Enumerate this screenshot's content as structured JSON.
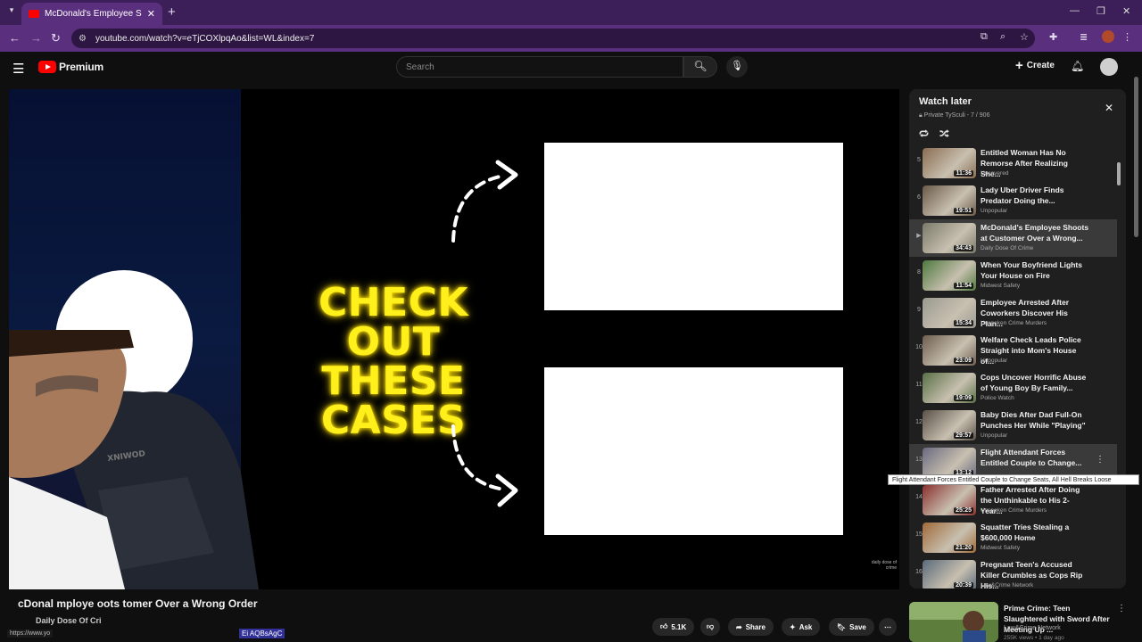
{
  "browser": {
    "tab_title": "McDonald's Employee Shoots a",
    "url": "youtube.com/watch?v=eTjCOXlpqAo&list=WL&index=7"
  },
  "header": {
    "logo_text": "Premium",
    "search_placeholder": "Search",
    "create_label": "Create"
  },
  "video": {
    "caption_line1": "CHECK OUT",
    "caption_line2": "THESE CASES",
    "watermark": "daily dose of crime",
    "title": "cDonal   mploye   oots   tomer Over a Wrong Order",
    "channel": "Daily Dose Of Cri",
    "status_url": "https://www.yo",
    "url_fragment": "Ei AQBsAgC"
  },
  "actions": {
    "likes": "5.1K",
    "share": "Share",
    "ask": "Ask",
    "save": "Save"
  },
  "playlist": {
    "title": "Watch later",
    "subtitle": "Private TySculi - 7 / 906",
    "items": [
      {
        "num": "5",
        "title": "Entitled Woman Has No Remorse After Realizing She...",
        "channel": "Uncovered",
        "duration": "11:36",
        "thumb_color": "#8a6d52"
      },
      {
        "num": "6",
        "title": "Lady Uber Driver Finds Predator Doing the...",
        "channel": "Unpopular",
        "duration": "19:51",
        "thumb_color": "#6b5a48"
      },
      {
        "num": "▶",
        "title": "McDonald's Employee Shoots at Customer Over a Wrong...",
        "channel": "Daily Dose Of Crime",
        "duration": "34:43",
        "thumb_color": "#7a7a6a"
      },
      {
        "num": "8",
        "title": "When Your Boyfriend Lights Your House on Fire",
        "channel": "Midwest Safety",
        "duration": "11:54",
        "thumb_color": "#4f7a3f"
      },
      {
        "num": "9",
        "title": "Employee Arrested After Coworkers Discover His Plan...",
        "channel": "Unspoken Crime Murders",
        "duration": "15:34",
        "thumb_color": "#9a9a90"
      },
      {
        "num": "10",
        "title": "Welfare Check Leads Police Straight into Mom's House of...",
        "channel": "Unpopular",
        "duration": "23:09",
        "thumb_color": "#6e5e50"
      },
      {
        "num": "11",
        "title": "Cops Uncover Horrific Abuse of Young Boy By Family...",
        "channel": "Police Watch",
        "duration": "19:09",
        "thumb_color": "#587046"
      },
      {
        "num": "12",
        "title": "Baby Dies After Dad Full-On Punches Her While \"Playing\"",
        "channel": "Unpopular",
        "duration": "29:57",
        "thumb_color": "#5a5048"
      },
      {
        "num": "13",
        "title": "Flight Attendant Forces Entitled Couple to Change...",
        "channel": "",
        "duration": "13:12",
        "thumb_color": "#6a6a80"
      },
      {
        "num": "14",
        "title": "Father Arrested After Doing the Unthinkable to His 2-Year...",
        "channel": "Unspoken Crime Murders",
        "duration": "25:25",
        "thumb_color": "#8a3030"
      },
      {
        "num": "15",
        "title": "Squatter Tries Stealing a $600,000 Home",
        "channel": "Midwest Safety",
        "duration": "21:20",
        "thumb_color": "#a06a3a"
      },
      {
        "num": "16",
        "title": "Pregnant Teen's Accused Killer Crumbles as Cops Rip His...",
        "channel": "Law&Crime Network",
        "duration": "20:39",
        "thumb_color": "#5a6a7a"
      }
    ],
    "tooltip": "Flight Attendant Forces Entitled Couple to Change Seats, All Hell Breaks Loose"
  },
  "recommended": {
    "title": "Prime Crime: Teen Slaughtered with Sword After Meeting Up ...",
    "channel": "Law&Crime Network",
    "meta": "255K views • 1 day ago"
  }
}
